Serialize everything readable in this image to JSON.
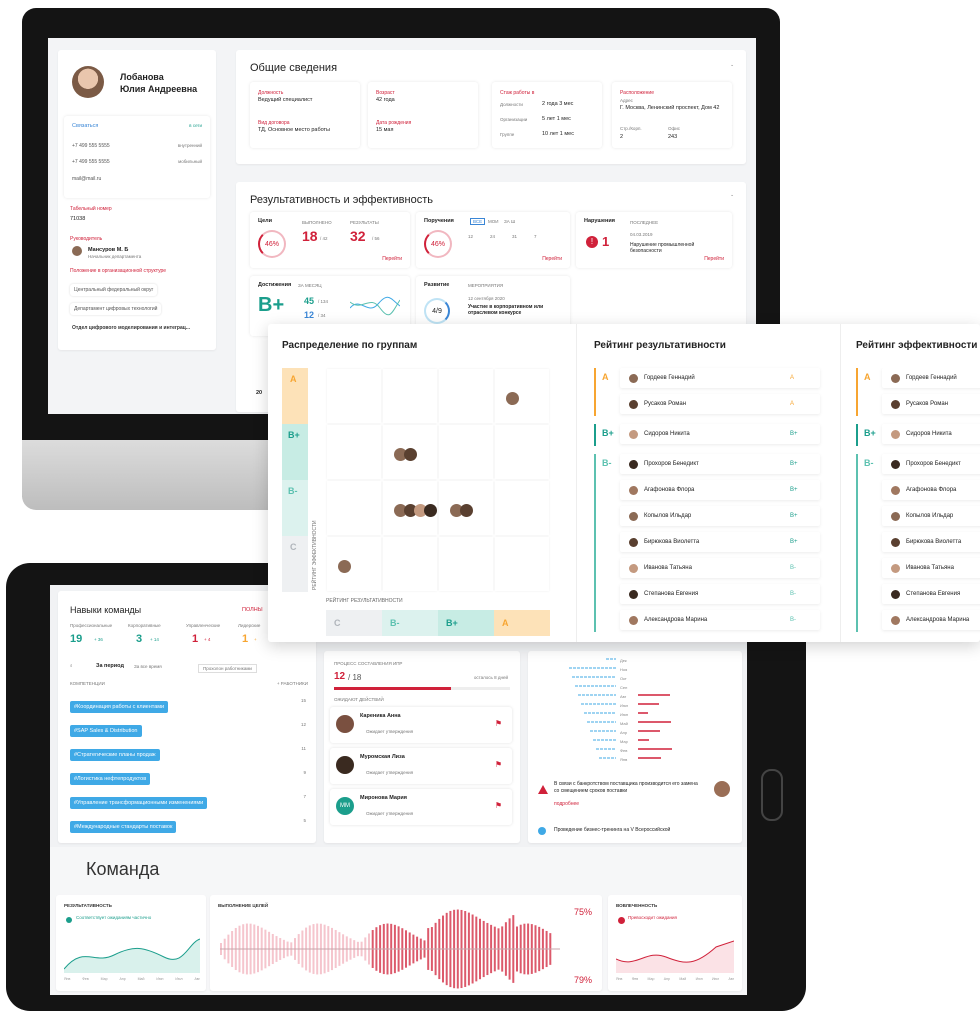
{
  "colors": {
    "accent": "#d0213a",
    "grade_a": "#f7a531",
    "grade_bplus": "#1b9e8c",
    "grade_bminus": "#5cc1b0",
    "grade_c": "#cfd3d8",
    "chip": "#3fa9e6"
  },
  "profile": {
    "name_line1": "Лобанова",
    "name_line2": "Юлия Андреевна",
    "contact_link": "Связаться",
    "status": "в сети",
    "phones": [
      {
        "number": "+7 499 555 5555",
        "type": "внутренний"
      },
      {
        "number": "+7 499 555 5555",
        "type": "мобильный"
      }
    ],
    "email": "mail@mail.ru",
    "tab_label": "Табельный номер",
    "tab_number": "71038",
    "manager_label": "Руководитель",
    "manager_name": "Мансуров М. Б",
    "manager_role": "Начальник департамента",
    "org_label": "Положение в организационной структуре",
    "org_items": [
      "Центральный федеральный округ",
      "Департамент цифровых технологий",
      "Отдел цифрового моделирования и интеграц..."
    ]
  },
  "general": {
    "title": "Общие сведения",
    "position_label": "Должность",
    "position": "Ведущий специалист",
    "age_label": "Возраст",
    "age": "42 года",
    "contract_label": "Вид договора",
    "contract": "ТД, Основное место работы",
    "birthday_label": "Дата рождения",
    "birthday": "15 мая",
    "exp_label": "Стаж работы в",
    "exp": [
      {
        "k": "Должности",
        "v": "2 года 3 мес"
      },
      {
        "k": "Организации",
        "v": "5 лет 1 мес"
      },
      {
        "k": "Группе",
        "v": "10 лет 1 мес"
      }
    ],
    "loc_label": "Расположение",
    "address_label": "Адрес",
    "address": "Г. Москва, Ленинский проспект, Дом 42",
    "building_label": "Стр./Корп.",
    "building": "2",
    "office_label": "Офис",
    "office": "243"
  },
  "performance": {
    "title": "Результативность и эффективность",
    "goals_label": "Цели",
    "goals_pct": "46%",
    "done_label": "ВЫПОЛНЕНО",
    "done": "18",
    "done_total": "/ 42",
    "results_label": "РЕЗУЛЬТАТЫ",
    "results": "32",
    "results_total": "/ 56",
    "goto": "Перейти",
    "orders_label": "Поручения",
    "orders_pct": "46%",
    "orders_tabs": [
      "ВСЕ",
      "МОИ",
      "ЗА Ш"
    ],
    "orders_counts": [
      "12",
      "24",
      "31",
      "7"
    ],
    "violations_label": "Нарушения",
    "violations_count": "1",
    "last_label": "ПОСЛЕДНЕЕ",
    "last_date": "04.03.2019",
    "last_text": "Нарушение промышленной безопасности",
    "ach_label": "Достижения",
    "ach_period": "ЗА МЕСЯЦ",
    "ach_grade": "B+",
    "ach_v1": "45",
    "ach_v1_total": "/ 134",
    "ach_v2": "12",
    "ach_v2_total": "/ 34",
    "dev_label": "Развитие",
    "dev_fraction": "4/9",
    "dev_sub": "МЕРОПРИЯТИЯ",
    "dev_date": "12 сентября 2020",
    "dev_text": "Участие в корпоративном или отраслевом конкурсе",
    "partial": "20"
  },
  "panel": {
    "dist_title": "Распределение по группам",
    "grid_rows": [
      "A",
      "B+",
      "B-",
      "C"
    ],
    "grid_cols": [
      "C",
      "B-",
      "B+",
      "A"
    ],
    "y_axis": "РЕЙТИНГ ЭФФЕКТИВНОСТИ",
    "x_axis": "РЕЙТИНГ РЕЗУЛЬТАТИВНОСТИ",
    "rating1_title": "Рейтинг результативности",
    "rating2_title": "Рейтинг эффективности",
    "groups": [
      "A",
      "B+",
      "B-"
    ],
    "people": [
      {
        "name": "Гордеев Геннадий",
        "g": "A"
      },
      {
        "name": "Русаков Роман",
        "g": "A"
      },
      {
        "name": "Сидоров Никита",
        "g": "B+"
      },
      {
        "name": "Прохоров Бенедикт",
        "g": "B+"
      },
      {
        "name": "Агафонова Флора",
        "g": "B+"
      },
      {
        "name": "Копылов Ильдар",
        "g": "B+"
      },
      {
        "name": "Бирюкова Виолетта",
        "g": "B+"
      },
      {
        "name": "Иванова Татьяна",
        "g": "B-"
      },
      {
        "name": "Степанова Евгения",
        "g": "B-"
      },
      {
        "name": "Александрова Марина",
        "g": "B-"
      }
    ],
    "people2": [
      "Гордеев Геннадий",
      "Русаков Роман",
      "Сидоров Никита",
      "Прохоров Бенедикт",
      "Агафонова Флора",
      "Копылов Ильдар",
      "Бирюкова Виолетта",
      "Иванова Татьяна",
      "Степанова Евгения",
      "Александрова Марина"
    ]
  },
  "skills": {
    "title": "Навыки команды",
    "full": "ПОЛНЫ",
    "cats": [
      {
        "label": "Профессиональные",
        "v": "19",
        "d": "+ 36"
      },
      {
        "label": "Корпоративные",
        "v": "3",
        "d": "+ 14"
      },
      {
        "label": "Управленческие",
        "v": "1",
        "d": "+ 4"
      },
      {
        "label": "Лидерские",
        "v": "1",
        "d": "+"
      }
    ],
    "period_on": "За период",
    "period_all": "За все время",
    "filter": "Прохолон работниками",
    "col1": "КОМПЕТЕНЦИИ",
    "col2": "+ РАБОТНИКИ",
    "items": [
      {
        "t": "#Координация работы с клиентами",
        "n": "15"
      },
      {
        "t": "#SAP Sales & Distribution",
        "n": "12"
      },
      {
        "t": "#Стратегические планы продаж",
        "n": "11"
      },
      {
        "t": "#Логистика нефтепродуктов",
        "n": "9"
      },
      {
        "t": "#Управление трансформационными изменениями",
        "n": "7"
      },
      {
        "t": "#Международные стандарты поставок",
        "n": "5"
      }
    ]
  },
  "ipr": {
    "progress_label": "ПРОЦЕСС СОСТАВЛЕНИЯ ИПР",
    "value": "12",
    "total": "/ 18",
    "remain": "осталось 8 дней",
    "wait_label": "ОЖИДАЮТ ДЕЙСТВИЙ",
    "people": [
      {
        "name": "Кареника Анна",
        "sub": "Ожидает утверждения"
      },
      {
        "name": "Муромская Лиза",
        "sub": "Ожидает утверждения"
      },
      {
        "name": "Миронова Мария",
        "sub": "Ожидает утверждения",
        "initials": "MM"
      }
    ]
  },
  "news": {
    "months": [
      "Дек",
      "Ноя",
      "Окт",
      "Сен",
      "Авг",
      "Июл",
      "Июн",
      "Май",
      "Апр",
      "Мар",
      "Фев",
      "Янв"
    ],
    "alert": "В связи с банкротством поставщика производится его замена со смещением сроков поставки",
    "more": "подробнее",
    "event": "Проведение бизнес-тренинга на V Всероссийской"
  },
  "team": {
    "title": "Команда",
    "res_label": "РЕЗУЛЬТАТИВНОСТЬ",
    "res_status": "Соответствует ожиданиям частично",
    "goals_label": "ВЫПОЛНЕНИЕ ЦЕЛЕЙ",
    "pct_top": "75%",
    "pct_bottom": "79%",
    "eng_label": "ВОВЛЕЧЕННОСТЬ",
    "eng_status": "Превосходит ожидания",
    "months": [
      "Янв",
      "Фев",
      "Мар",
      "Апр",
      "Май",
      "Июн",
      "Июл",
      "Авг"
    ]
  }
}
